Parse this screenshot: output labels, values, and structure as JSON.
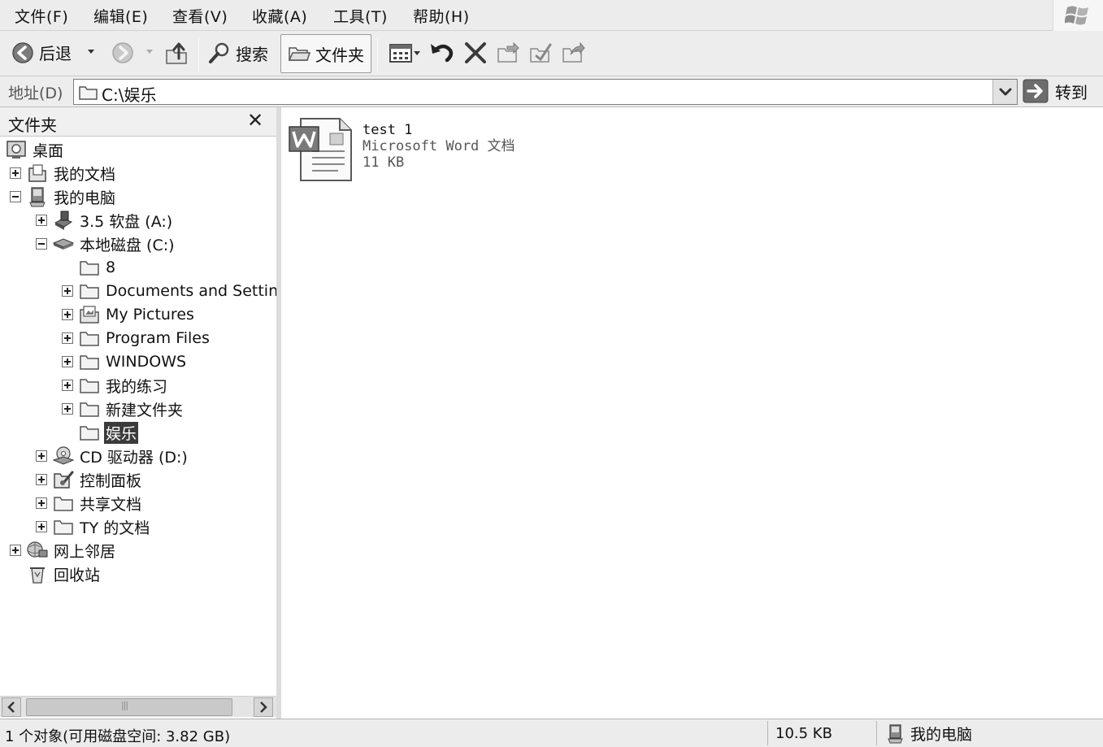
{
  "menu": {
    "items": [
      "文件(F)",
      "编辑(E)",
      "查看(V)",
      "收藏(A)",
      "工具(T)",
      "帮助(H)"
    ]
  },
  "toolbar": {
    "back_label": "后退",
    "search_label": "搜索",
    "folders_label": "文件夹"
  },
  "address": {
    "label": "地址(D)",
    "value": "C:\\娱乐",
    "go_label": "转到"
  },
  "folder_pane": {
    "title": "文件夹",
    "close_glyph": "✕",
    "tree": [
      {
        "label": "桌面",
        "icon": "desktop-icon",
        "expander": "none",
        "selected": false
      },
      {
        "label": "我的文档",
        "icon": "my-documents-icon",
        "expander": "plus",
        "selected": false
      },
      {
        "label": "我的电脑",
        "icon": "my-computer-icon",
        "expander": "minus",
        "selected": false
      },
      {
        "label": "3.5 软盘 (A:)",
        "icon": "floppy-drive-icon",
        "expander": "plus",
        "selected": false
      },
      {
        "label": "本地磁盘 (C:)",
        "icon": "hard-drive-icon",
        "expander": "minus",
        "selected": false
      },
      {
        "label": "8",
        "icon": "folder-icon",
        "expander": "none",
        "selected": false
      },
      {
        "label": "Documents and Settin",
        "icon": "folder-icon",
        "expander": "plus",
        "selected": false
      },
      {
        "label": "My Pictures",
        "icon": "pictures-folder-icon",
        "expander": "plus",
        "selected": false
      },
      {
        "label": "Program Files",
        "icon": "folder-icon",
        "expander": "plus",
        "selected": false
      },
      {
        "label": "WINDOWS",
        "icon": "folder-icon",
        "expander": "plus",
        "selected": false
      },
      {
        "label": "我的练习",
        "icon": "folder-icon",
        "expander": "plus",
        "selected": false
      },
      {
        "label": "新建文件夹",
        "icon": "folder-icon",
        "expander": "plus",
        "selected": false
      },
      {
        "label": "娱乐",
        "icon": "folder-icon",
        "expander": "none",
        "selected": true
      },
      {
        "label": "CD 驱动器 (D:)",
        "icon": "cd-drive-icon",
        "expander": "plus",
        "selected": false
      },
      {
        "label": "控制面板",
        "icon": "control-panel-icon",
        "expander": "plus",
        "selected": false
      },
      {
        "label": "共享文档",
        "icon": "folder-icon",
        "expander": "plus",
        "selected": false
      },
      {
        "label": "TY 的文档",
        "icon": "folder-icon",
        "expander": "plus",
        "selected": false
      },
      {
        "label": "网上邻居",
        "icon": "network-icon",
        "expander": "plus",
        "selected": false
      },
      {
        "label": "回收站",
        "icon": "recycle-bin-icon",
        "expander": "none",
        "selected": false
      }
    ]
  },
  "content": {
    "files": [
      {
        "name": "test 1",
        "type": "Microsoft Word 文档",
        "size": "11 KB",
        "icon": "word-document-icon"
      }
    ]
  },
  "status": {
    "objects": "1 个对象(可用磁盘空间: 3.82 GB)",
    "size": "10.5 KB",
    "computer": "我的电脑"
  }
}
